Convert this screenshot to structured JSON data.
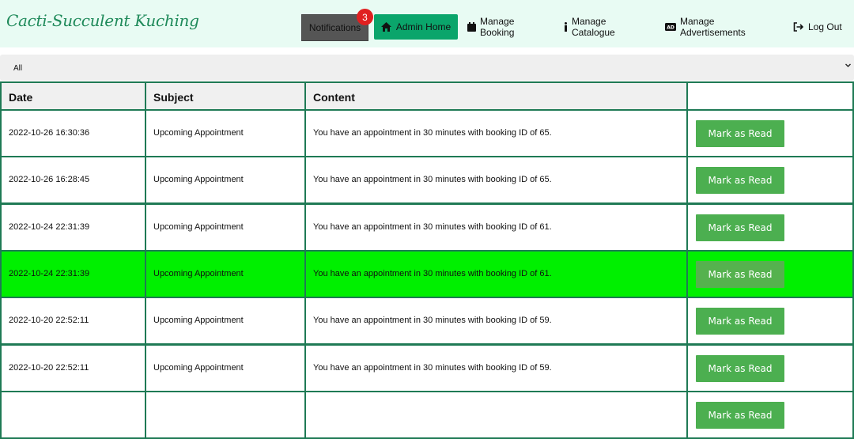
{
  "brand": "Cacti-Succulent Kuching",
  "nav": {
    "notifications_label": "Notifications",
    "notifications_count": "3",
    "admin_home": "Admin Home",
    "manage_booking": "Manage Booking",
    "manage_catalogue": "Manage Catalogue",
    "manage_ads": "Manage Advertisements",
    "logout": "Log Out"
  },
  "filter": {
    "selected": "All"
  },
  "table": {
    "headers": [
      "Date",
      "Subject",
      "Content",
      ""
    ],
    "action_label": "Mark as Read",
    "rows": [
      {
        "date": "2022-10-26 16:30:36",
        "subject": "Upcoming Appointment",
        "content": "You have an appointment in 30 minutes with booking ID of 65."
      },
      {
        "date": "2022-10-26 16:28:45",
        "subject": "Upcoming Appointment",
        "content": "You have an appointment in 30 minutes with booking ID of 65."
      },
      {
        "date": "2022-10-24 22:31:39",
        "subject": "Upcoming Appointment",
        "content": "You have an appointment in 30 minutes with booking ID of 61."
      },
      {
        "date": "2022-10-24 22:31:39",
        "subject": "Upcoming Appointment",
        "content": "You have an appointment in 30 minutes with booking ID of 61.",
        "highlighted": true
      },
      {
        "date": "2022-10-20 22:52:11",
        "subject": "Upcoming Appointment",
        "content": "You have an appointment in 30 minutes with booking ID of 59."
      },
      {
        "date": "2022-10-20 22:52:11",
        "subject": "Upcoming Appointment",
        "content": "You have an appointment in 30 minutes with booking ID of 59."
      },
      {
        "date": "",
        "subject": "",
        "content": ""
      }
    ]
  },
  "colors": {
    "border": "#1f7a55",
    "highlight": "#00f000",
    "button": "#4caf50",
    "admin_button": "#0aa56b",
    "topbar": "#e8fbf3"
  }
}
